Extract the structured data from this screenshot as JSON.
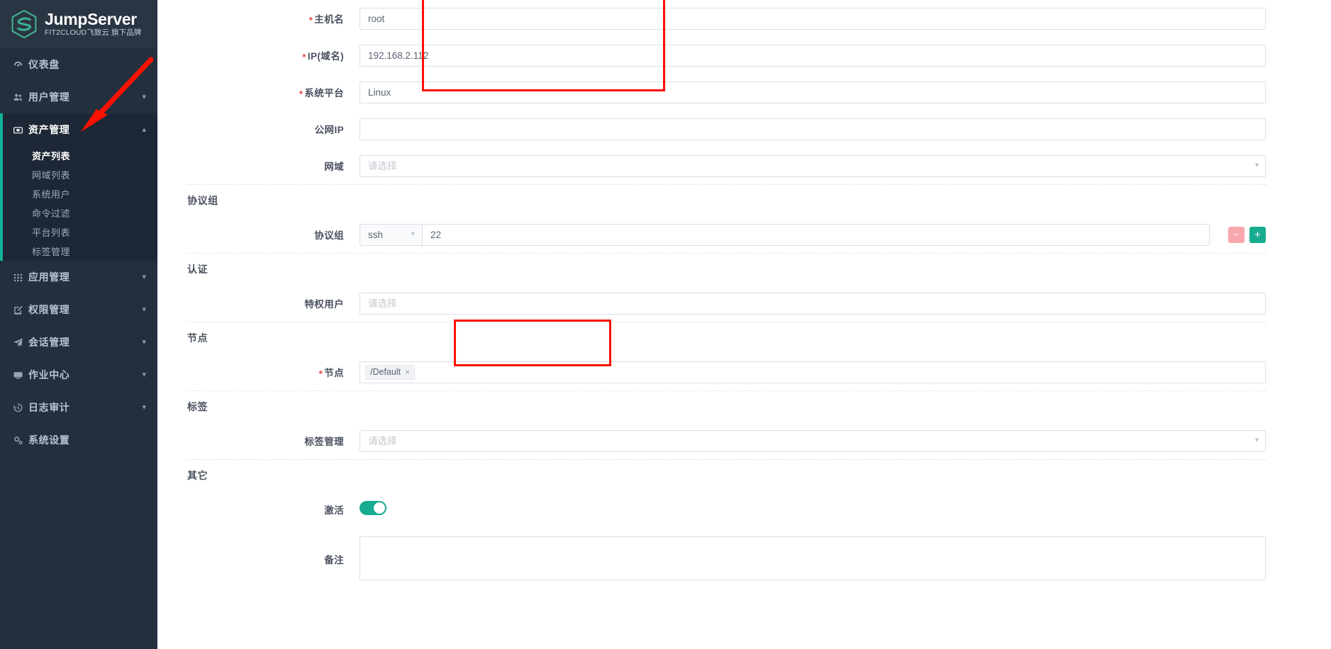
{
  "brand": {
    "title": "JumpServer",
    "subtitle": "FIT2CLOUD飞致云 旗下品牌",
    "logo_icon": "jumpserver-logo-icon",
    "accent_color": "#10b397",
    "sidebar_bg": "#242f3e"
  },
  "sidebar": {
    "items": [
      {
        "label": "仪表盘",
        "icon": "dashboard-icon",
        "expandable": false
      },
      {
        "label": "用户管理",
        "icon": "users-icon",
        "expandable": true
      },
      {
        "label": "资产管理",
        "icon": "asset-box-icon",
        "expandable": true,
        "expanded": true
      },
      {
        "label": "应用管理",
        "icon": "grid-apps-icon",
        "expandable": true
      },
      {
        "label": "权限管理",
        "icon": "edit-square-icon",
        "expandable": true
      },
      {
        "label": "会话管理",
        "icon": "paper-plane-icon",
        "expandable": true
      },
      {
        "label": "作业中心",
        "icon": "terminal-icon",
        "expandable": true
      },
      {
        "label": "日志审计",
        "icon": "history-clock-icon",
        "expandable": true
      },
      {
        "label": "系统设置",
        "icon": "gears-icon",
        "expandable": false
      }
    ],
    "submenu": [
      {
        "label": "资产列表",
        "active": true
      },
      {
        "label": "网域列表",
        "active": false
      },
      {
        "label": "系统用户",
        "active": false
      },
      {
        "label": "命令过滤",
        "active": false
      },
      {
        "label": "平台列表",
        "active": false
      },
      {
        "label": "标签管理",
        "active": false
      }
    ]
  },
  "form": {
    "basic": {
      "hostname": {
        "label": "主机名",
        "required": true,
        "value": "root",
        "placeholder": ""
      },
      "ip": {
        "label": "IP(域名)",
        "required": true,
        "value": "192.168.2.112",
        "placeholder": ""
      },
      "platform": {
        "label": "系统平台",
        "required": true,
        "value": "Linux",
        "placeholder": ""
      },
      "public_ip": {
        "label": "公网IP",
        "required": false,
        "value": "",
        "placeholder": ""
      },
      "domain": {
        "label": "网域",
        "required": false,
        "value": "",
        "placeholder": "请选择",
        "chevron": "chevron-down-icon"
      }
    },
    "protocol_section": {
      "title": "协议组",
      "row_label": "协议组",
      "protocol_value": "ssh",
      "port_value": "22",
      "remove_label": "−",
      "add_label": "+",
      "remove_color": "#f7a7ad",
      "add_color": "#17ac8f"
    },
    "auth_section": {
      "title": "认证",
      "privileged_user": {
        "label": "特权用户",
        "required": false,
        "value": "",
        "placeholder": "请选择"
      }
    },
    "node_section": {
      "title": "节点",
      "node": {
        "label": "节点",
        "required": true,
        "tag": "/Default",
        "tag_remove": "×"
      }
    },
    "label_section": {
      "title": "标签",
      "label_manage": {
        "label": "标签管理",
        "required": false,
        "value": "",
        "placeholder": "请选择",
        "chevron": "chevron-down-icon"
      }
    },
    "other_section": {
      "title": "其它",
      "active_toggle": {
        "label": "激活",
        "on": true
      },
      "remark": {
        "label": "备注",
        "value": "",
        "placeholder": ""
      }
    }
  },
  "annotations": {
    "highlight_color": "#fb1100",
    "arrow": {
      "name": "red-arrow-pointer",
      "target": "资产列表"
    }
  }
}
